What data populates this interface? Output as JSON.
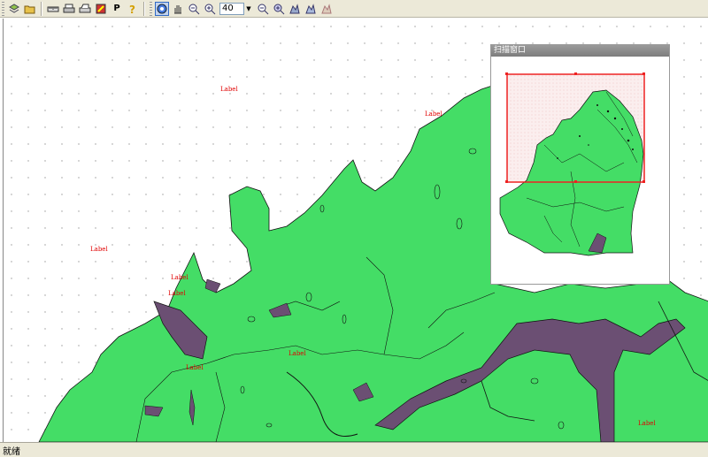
{
  "toolbar": {
    "buttons": [
      "layers",
      "open",
      "ruler",
      "print",
      "print-preview",
      "export",
      "P",
      "help"
    ],
    "zoom_value": "40",
    "nav_buttons": [
      "select",
      "pan",
      "zoom-out",
      "zoom-in"
    ],
    "view_buttons": [
      "zoom-out-2",
      "zoom-in-2",
      "full-extent",
      "previous-extent",
      "next-extent"
    ]
  },
  "overview": {
    "title": "扫描窗口"
  },
  "map": {
    "labels": [
      "Label",
      "Label",
      "Label",
      "Label",
      "Label",
      "Label",
      "Label",
      "Label"
    ]
  },
  "status": {
    "text": "就绪"
  },
  "colors": {
    "land": "#44dd66",
    "water": "#6b4f73",
    "outline": "#111111",
    "label": "#e00000",
    "extent": "#ee2222"
  }
}
